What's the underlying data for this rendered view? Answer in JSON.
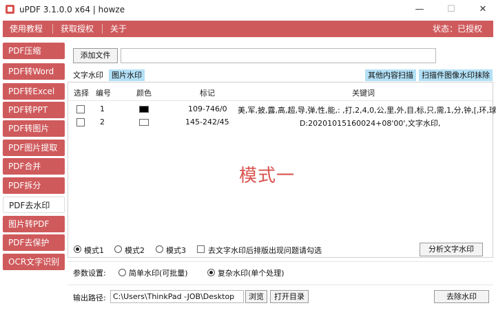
{
  "window": {
    "title": "uPDF 3.1.0.0 x64 | howze",
    "min": "—",
    "max": "☐",
    "close": "✕"
  },
  "menu": {
    "items": [
      "使用教程",
      "获取授权",
      "关于"
    ],
    "status": "状态：已授权"
  },
  "sidebar": {
    "items": [
      {
        "label": "PDF压缩"
      },
      {
        "label": "PDF转Word"
      },
      {
        "label": "PDF转Excel"
      },
      {
        "label": "PDF转PPT"
      },
      {
        "label": "PDF转图片"
      },
      {
        "label": "PDF图片提取"
      },
      {
        "label": "PDF合并"
      },
      {
        "label": "PDF拆分"
      },
      {
        "label": "PDF去水印"
      },
      {
        "label": "图片转PDF"
      },
      {
        "label": "PDF去保护"
      },
      {
        "label": "OCR文字识别"
      }
    ],
    "active_index": 8
  },
  "main": {
    "add_file_button": "添加文件",
    "file_path_value": "",
    "tabs": [
      "文字水印",
      "图片水印"
    ],
    "right_buttons": [
      "其他内容扫描",
      "扫描件图像水印抹除"
    ],
    "table": {
      "headers": [
        "选择",
        "编号",
        "颜色",
        "标记",
        "关键词"
      ],
      "rows": [
        {
          "num": "1",
          "color": "#000000",
          "mark": "109-746/0",
          "keywords": "美,军,披,露,高,超,导,弹,性,能,: ,打,2,4,0,公,里,外,目,标,只,需,1,分,钟,[,环,球,网"
        },
        {
          "num": "2",
          "color": "#ffffff",
          "mark": "145-242/45",
          "keywords": "D:20201015160024+08'00',文字水印,"
        }
      ]
    },
    "mode_title": "模式一",
    "modes": [
      "模式1",
      "模式2",
      "模式3"
    ],
    "checkbox_label": "去文字水印后排版出现问题请勾选",
    "analyze_button": "分析文字水印",
    "params_label": "参数设置:",
    "param_options": [
      "简单水印(可批量)",
      "复杂水印(单个处理)"
    ],
    "output_label": "输出路径:",
    "output_path": "C:\\Users\\ThinkPad -JOB\\Desktop",
    "browse_button": "浏览",
    "open_dir_button": "打开目录",
    "remove_button": "去除水印"
  },
  "colors": {
    "accent": "#cf5a5c",
    "tab_highlight": "#b3e0f5",
    "mode_text": "#d9534f"
  }
}
